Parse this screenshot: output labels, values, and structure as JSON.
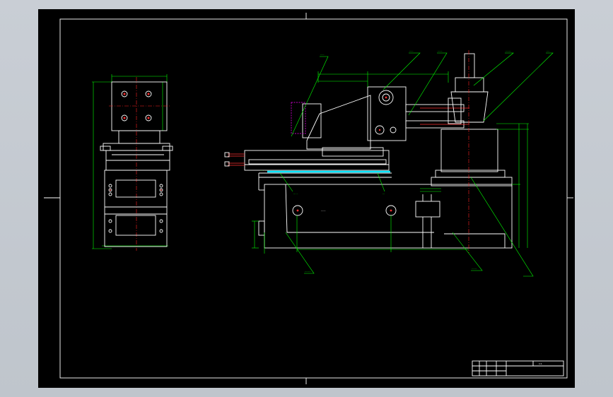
{
  "colors": {
    "background": "#000000",
    "frame": "#ffffff",
    "outline": "#ffffff",
    "dimension": "#00ff00",
    "centerline": "#ff0000",
    "hidden": "#ff00ff",
    "highlight": "#00e5ff",
    "window_bg": "#c6ccd3"
  },
  "icons": {
    "drill-spindle": "drill-spindle-icon",
    "hole-pattern": "bolt-hole-icon"
  },
  "labels": {
    "callout_1": "-----",
    "callout_2": "-----",
    "callout_3": "------",
    "callout_4": "-------",
    "callout_5": "----",
    "callout_6": "--------",
    "callout_7": "-------",
    "slide_tag": "---- --",
    "bore_tag_left": "--- --",
    "bore_tag_right": "---",
    "base_tag": "------"
  },
  "title_block": {
    "scale_text": "1:1"
  }
}
